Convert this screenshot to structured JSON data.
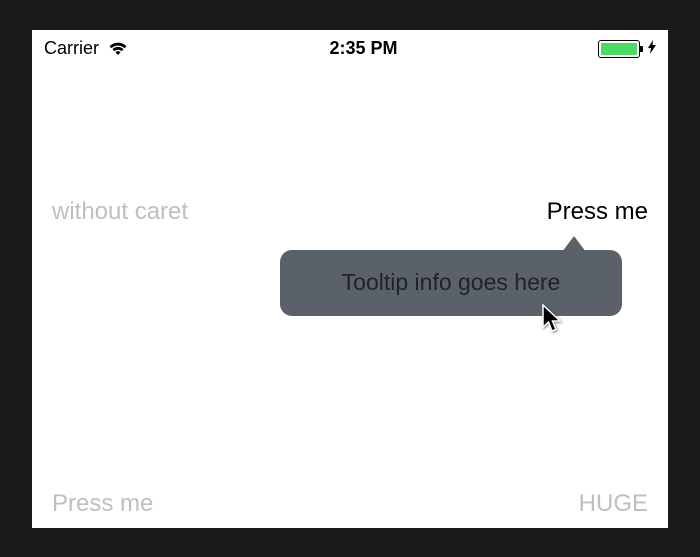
{
  "statusBar": {
    "carrier": "Carrier",
    "time": "2:35 PM"
  },
  "row1": {
    "leftLabel": "without caret",
    "rightButton": "Press me"
  },
  "tooltip": {
    "text": "Tooltip info goes here"
  },
  "row2": {
    "leftButton": "Press me",
    "rightButton": "HUGE"
  },
  "colors": {
    "tooltipBg": "#5a6169",
    "batteryFill": "#4cd964",
    "grayText": "#bfbfbf"
  }
}
